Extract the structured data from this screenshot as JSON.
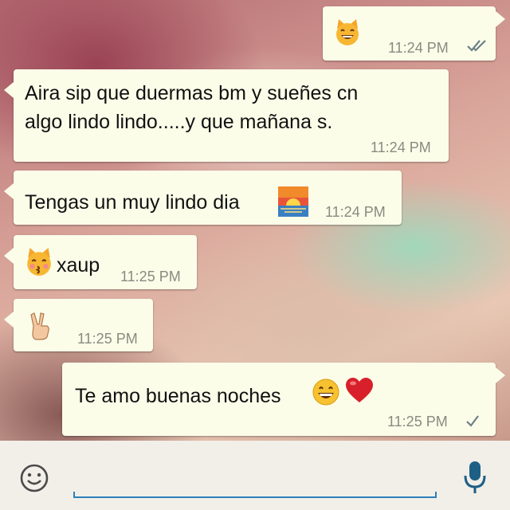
{
  "messages": [
    {
      "direction": "outgoing",
      "text": "",
      "emoji": "grinning-cat-emoji",
      "time": "11:24 PM",
      "status": "double-tick"
    },
    {
      "direction": "incoming",
      "line1": "Aira sip que duermas bm y sueñes cn",
      "line2": "algo lindo lindo.....y que mañana s.",
      "time": "11:24 PM"
    },
    {
      "direction": "incoming",
      "text": "Tengas un muy lindo dia",
      "emoji": "sunrise-emoji",
      "time": "11:24 PM"
    },
    {
      "direction": "incoming",
      "text": "xaup",
      "emoji": "kissing-cat-emoji",
      "time": "11:25 PM"
    },
    {
      "direction": "incoming",
      "text": "",
      "emoji": "victory-hand-emoji",
      "time": "11:25 PM"
    },
    {
      "direction": "outgoing",
      "text": "Te amo buenas noches",
      "emoji": "grinning-face-emoji, red-heart-emoji",
      "time": "11:25 PM",
      "status": "single-tick"
    }
  ],
  "input_bar": {
    "emoji_button_icon": "smiley-icon",
    "mic_button_icon": "microphone-icon",
    "message_input_value": ""
  },
  "colors": {
    "bubble": "#fbfde9",
    "time_text": "#8a8a80",
    "input_underline": "#2d7fb8",
    "icon": "#1e5f86"
  }
}
